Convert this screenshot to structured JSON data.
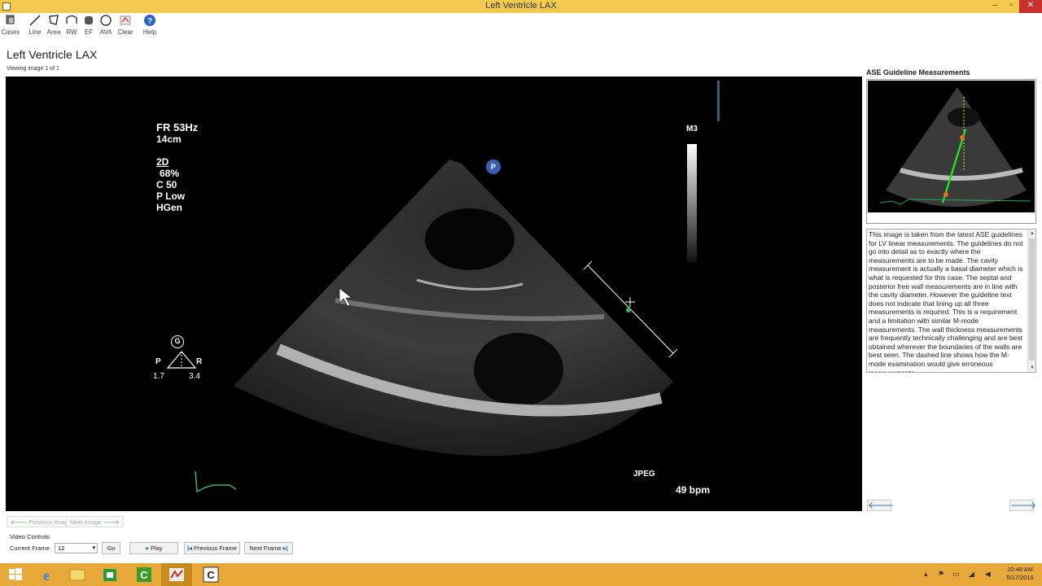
{
  "window": {
    "title": "Left Ventricle LAX",
    "minimize": "–",
    "maximize": "▫",
    "close": "✕"
  },
  "toolbar": {
    "items": [
      {
        "label": "Cases",
        "icon": "cases-icon"
      },
      {
        "label": "Line",
        "icon": "line-icon"
      },
      {
        "label": "Area",
        "icon": "area-icon"
      },
      {
        "label": "RW",
        "icon": "rw-icon"
      },
      {
        "label": "EF",
        "icon": "ef-icon"
      },
      {
        "label": "AVA",
        "icon": "ava-icon"
      },
      {
        "label": "Clear",
        "icon": "clear-icon"
      },
      {
        "label": "Help",
        "icon": "help-icon"
      }
    ]
  },
  "page": {
    "title": "Left Ventricle LAX",
    "viewing": "Viewing image 1 of 1"
  },
  "echo": {
    "fr": "FR 53Hz",
    "depth": "14cm",
    "mode": "2D",
    "gain": "68%",
    "compress": "C 50",
    "power": "P Low",
    "freq": "HGen",
    "m3": "M3",
    "probe_marker": "P",
    "g_marker": "G",
    "p_left": "P",
    "r_right": "R",
    "val_left": "1.7",
    "val_right": "3.4",
    "format": "JPEG",
    "bpm": "49 bpm"
  },
  "guideline": {
    "title": "ASE Guideline Measurements",
    "description": "This image is taken from the latest ASE guidelines for LV linear measurements. The guidelines do not go into detail as to exactly where the measurements are to be made. The cavity measurement is actually a basal diameter which is what is requested for this case. The septal and posterior free wall measurements are in line with the cavity diameter. However the guideline text does not indicate that lining up all three measurements is required. This is a requirement and a limitation with similar M-mode measurements. The wall thickness measurements are frequently technically challenging and are best obtained wherever the boundaries of the walls are best seen. The dashed line shows how the M-mode examination would give erroneous measurements.",
    "prev_arrow": "🡐",
    "next_arrow": "🡒"
  },
  "image_nav": {
    "previous": "Previous Image",
    "next": "Next Image"
  },
  "video": {
    "section_label": "Video Controls",
    "current_frame_label": "Current Frame",
    "current_frame_value": "12",
    "go": "Go",
    "play": "Play",
    "previous_frame": "Previous Frame",
    "next_frame": "Next Frame"
  },
  "clock": {
    "time": "10:48 AM",
    "date": "5/17/2016"
  },
  "colors": {
    "titlebar": "#f3c94e",
    "taskbar": "#e9a93a",
    "accent": "#2a7ac8"
  }
}
